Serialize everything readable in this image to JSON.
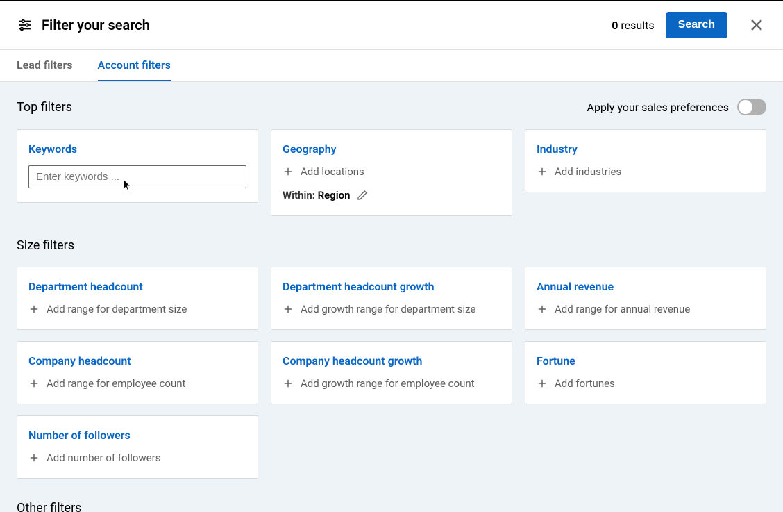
{
  "header": {
    "title": "Filter your search",
    "results_count": "0",
    "results_word": "results",
    "search_label": "Search"
  },
  "tabs": {
    "lead": "Lead filters",
    "account": "Account filters"
  },
  "prefs": {
    "label": "Apply your sales preferences"
  },
  "sections": {
    "top": "Top filters",
    "size": "Size filters",
    "other": "Other filters"
  },
  "top_filters": {
    "keywords": {
      "title": "Keywords",
      "placeholder": "Enter keywords ..."
    },
    "geography": {
      "title": "Geography",
      "add_text": "Add locations",
      "within_label": "Within:",
      "within_value": "Region"
    },
    "industry": {
      "title": "Industry",
      "add_text": "Add industries"
    }
  },
  "size_filters": {
    "dept_headcount": {
      "title": "Department headcount",
      "add_text": "Add range for department size"
    },
    "dept_growth": {
      "title": "Department headcount growth",
      "add_text": "Add growth range for department size"
    },
    "annual_revenue": {
      "title": "Annual revenue",
      "add_text": "Add range for annual revenue"
    },
    "company_headcount": {
      "title": "Company headcount",
      "add_text": "Add range for employee count"
    },
    "company_growth": {
      "title": "Company headcount growth",
      "add_text": "Add growth range for employee count"
    },
    "fortune": {
      "title": "Fortune",
      "add_text": "Add fortunes"
    },
    "followers": {
      "title": "Number of followers",
      "add_text": "Add number of followers"
    }
  }
}
